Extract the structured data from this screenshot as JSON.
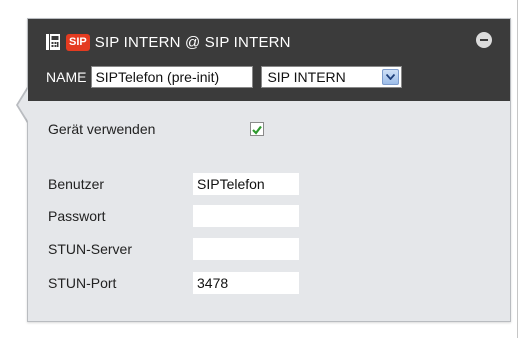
{
  "header": {
    "badge": "SIP",
    "title": "SIP INTERN @ SIP INTERN",
    "icons": [
      "phone-icon",
      "collapse-icon"
    ]
  },
  "name_row": {
    "label": "NAME",
    "name_value": "SIPTelefon (pre-init)",
    "select_value": "SIP INTERN"
  },
  "form": {
    "use_device_label": "Gerät verwenden",
    "use_device_checked": true,
    "fields": [
      {
        "label": "Benutzer",
        "value": "SIPTelefon"
      },
      {
        "label": "Passwort",
        "value": ""
      },
      {
        "label": "STUN-Server",
        "value": ""
      },
      {
        "label": "STUN-Port",
        "value": "3478"
      }
    ]
  },
  "colors": {
    "header_bg": "#3b3b3b",
    "panel_bg": "#e5e7ea",
    "badge": "#e43b20",
    "check": "#2e9a2e"
  }
}
